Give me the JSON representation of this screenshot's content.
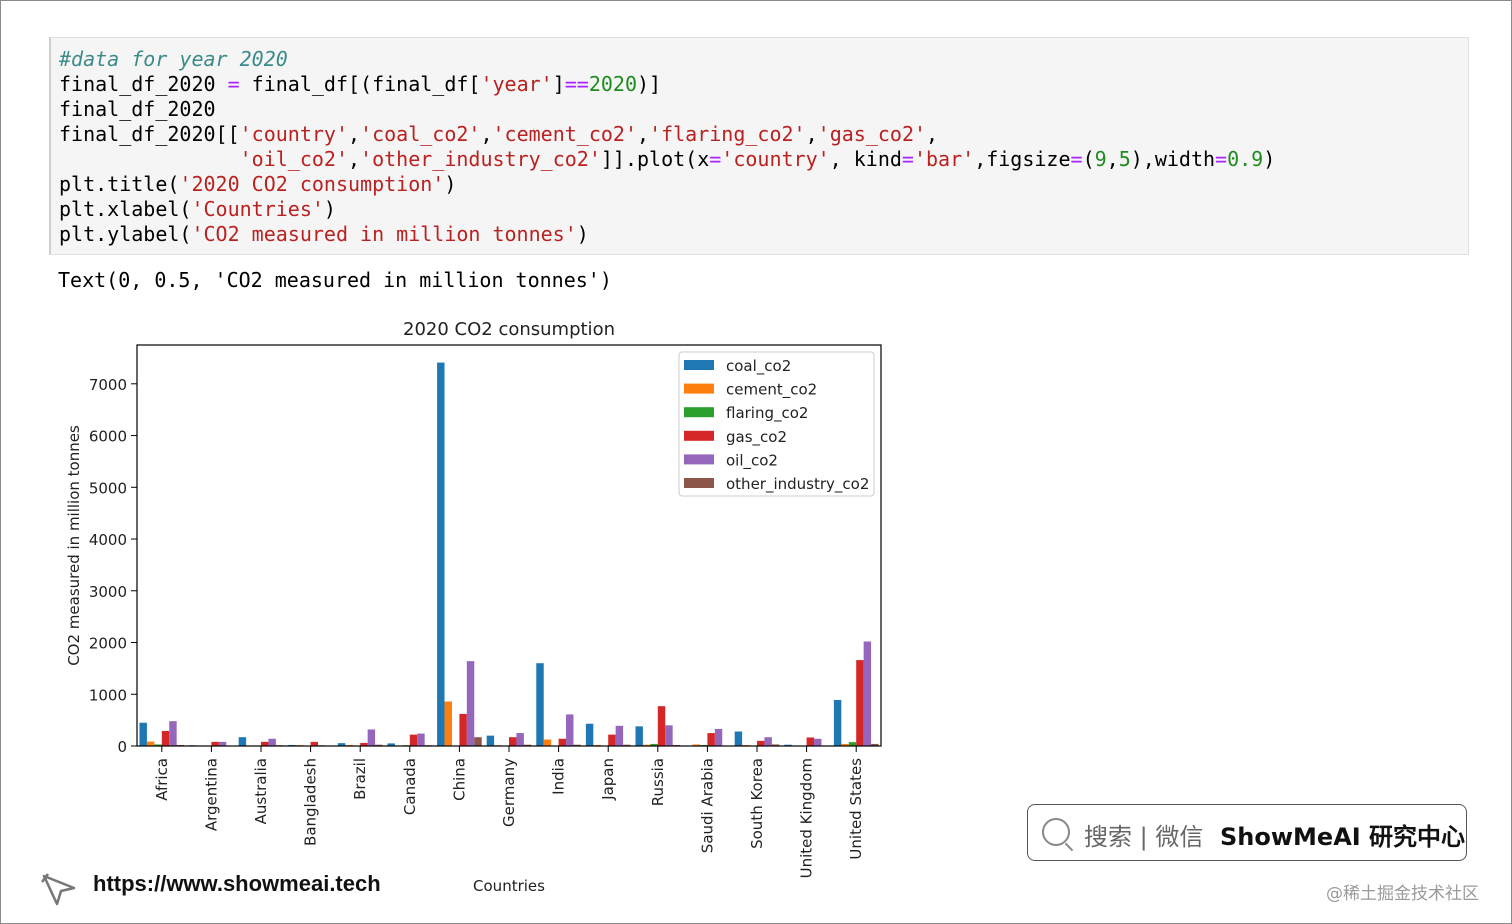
{
  "notebook": {
    "code_lines": [
      [
        {
          "t": "#data for year 2020",
          "c": "cm"
        }
      ],
      [
        {
          "t": "final_df_2020 "
        },
        {
          "t": "=",
          "c": "op"
        },
        {
          "t": " final_df[(final_df["
        },
        {
          "t": "'year'",
          "c": "st"
        },
        {
          "t": "]"
        },
        {
          "t": "==",
          "c": "op"
        },
        {
          "t": "2020",
          "c": "nu"
        },
        {
          "t": ")]"
        }
      ],
      [
        {
          "t": "final_df_2020"
        }
      ],
      [
        {
          "t": "final_df_2020[["
        },
        {
          "t": "'country'",
          "c": "st"
        },
        {
          "t": ","
        },
        {
          "t": "'coal_co2'",
          "c": "st"
        },
        {
          "t": ","
        },
        {
          "t": "'cement_co2'",
          "c": "st"
        },
        {
          "t": ","
        },
        {
          "t": "'flaring_co2'",
          "c": "st"
        },
        {
          "t": ","
        },
        {
          "t": "'gas_co2'",
          "c": "st"
        },
        {
          "t": ","
        }
      ],
      [
        {
          "t": "               "
        },
        {
          "t": "'oil_co2'",
          "c": "st"
        },
        {
          "t": ","
        },
        {
          "t": "'other_industry_co2'",
          "c": "st"
        },
        {
          "t": "]].plot(x"
        },
        {
          "t": "=",
          "c": "op"
        },
        {
          "t": "'country'",
          "c": "st"
        },
        {
          "t": ", kind"
        },
        {
          "t": "=",
          "c": "op"
        },
        {
          "t": "'bar'",
          "c": "st"
        },
        {
          "t": ",figsize"
        },
        {
          "t": "=",
          "c": "op"
        },
        {
          "t": "("
        },
        {
          "t": "9",
          "c": "nu"
        },
        {
          "t": ","
        },
        {
          "t": "5",
          "c": "nu"
        },
        {
          "t": "),width"
        },
        {
          "t": "=",
          "c": "op"
        },
        {
          "t": "0.9",
          "c": "nu"
        },
        {
          "t": ")"
        }
      ],
      [
        {
          "t": "plt.title("
        },
        {
          "t": "'2020 CO2 consumption'",
          "c": "st"
        },
        {
          "t": ")"
        }
      ],
      [
        {
          "t": "plt.xlabel("
        },
        {
          "t": "'Countries'",
          "c": "st"
        },
        {
          "t": ")"
        }
      ],
      [
        {
          "t": "plt.ylabel("
        },
        {
          "t": "'CO2 measured in million tonnes'",
          "c": "st"
        },
        {
          "t": ")"
        }
      ]
    ],
    "output_text": "Text(0, 0.5, 'CO2 measured in million tonnes')"
  },
  "chart_data": {
    "type": "bar",
    "title": "2020 CO2 consumption",
    "xlabel": "Countries",
    "ylabel": "CO2 measured in million tonnes",
    "ylim": [
      0,
      7750
    ],
    "yticks": [
      0,
      1000,
      2000,
      3000,
      4000,
      5000,
      6000,
      7000
    ],
    "grid": false,
    "legend_position": "top-right",
    "categories": [
      "Africa",
      "Argentina",
      "Australia",
      "Bangladesh",
      "Brazil",
      "Canada",
      "China",
      "Germany",
      "India",
      "Japan",
      "Russia",
      "Saudi Arabia",
      "South Korea",
      "United Kingdom",
      "United States"
    ],
    "series": [
      {
        "name": "coal_co2",
        "color": "#1f77b4",
        "values": [
          450,
          15,
          170,
          20,
          55,
          50,
          7410,
          200,
          1600,
          430,
          380,
          5,
          280,
          25,
          890
        ]
      },
      {
        "name": "cement_co2",
        "color": "#ff7f0e",
        "values": [
          85,
          5,
          5,
          18,
          20,
          10,
          860,
          15,
          125,
          20,
          25,
          30,
          20,
          5,
          40
        ]
      },
      {
        "name": "flaring_co2",
        "color": "#2ca02c",
        "values": [
          30,
          5,
          10,
          0,
          10,
          15,
          0,
          0,
          0,
          0,
          40,
          20,
          0,
          5,
          75
        ]
      },
      {
        "name": "gas_co2",
        "color": "#d62728",
        "values": [
          290,
          80,
          80,
          80,
          60,
          220,
          620,
          170,
          140,
          220,
          770,
          250,
          100,
          165,
          1660
        ]
      },
      {
        "name": "oil_co2",
        "color": "#9467bd",
        "values": [
          480,
          80,
          140,
          15,
          320,
          240,
          1640,
          250,
          610,
          390,
          400,
          330,
          170,
          140,
          2020
        ]
      },
      {
        "name": "other_industry_co2",
        "color": "#8c564b",
        "values": [
          20,
          5,
          15,
          5,
          25,
          15,
          170,
          25,
          25,
          25,
          20,
          5,
          30,
          10,
          40
        ]
      }
    ]
  },
  "branding": {
    "search_prefix": "搜索 | 微信",
    "search_brand": "ShowMeAI 研究中心",
    "url": "https://www.showmeai.tech",
    "watermark": "@稀土掘金技术社区"
  }
}
